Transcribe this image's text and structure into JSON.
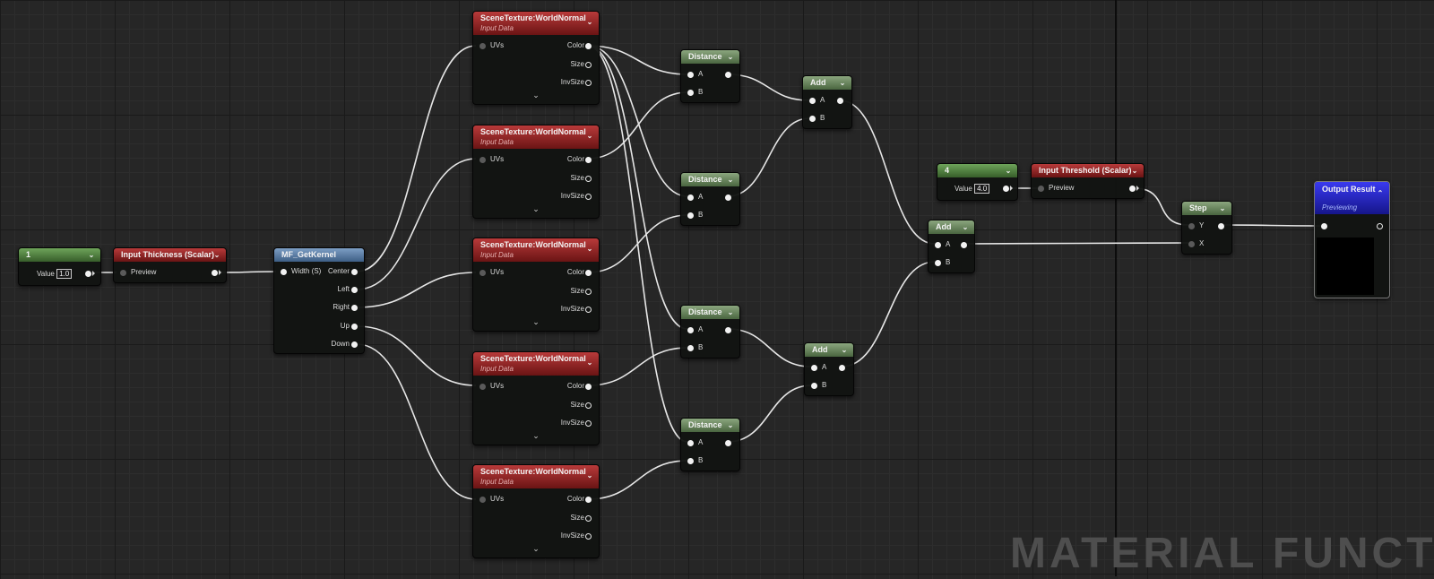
{
  "watermark": "MATERIAL FUNCTIO",
  "nodes": {
    "const1": {
      "title": "1",
      "value_label": "Value",
      "value": "1.0"
    },
    "thickness": {
      "title": "Input Thickness (Scalar)",
      "pin_label": "Preview"
    },
    "kernel": {
      "title": "MF_GetKernel",
      "input_label": "Width (S)",
      "outputs": [
        "Center",
        "Left",
        "Right",
        "Up",
        "Down"
      ]
    },
    "scenetex": [
      {
        "title": "SceneTexture:WorldNormal",
        "subtitle": "Input Data",
        "input": "UVs",
        "outputs": [
          "Color",
          "Size",
          "InvSize"
        ]
      },
      {
        "title": "SceneTexture:WorldNormal",
        "subtitle": "Input Data",
        "input": "UVs",
        "outputs": [
          "Color",
          "Size",
          "InvSize"
        ]
      },
      {
        "title": "SceneTexture:WorldNormal",
        "subtitle": "Input Data",
        "input": "UVs",
        "outputs": [
          "Color",
          "Size",
          "InvSize"
        ]
      },
      {
        "title": "SceneTexture:WorldNormal",
        "subtitle": "Input Data",
        "input": "UVs",
        "outputs": [
          "Color",
          "Size",
          "InvSize"
        ]
      },
      {
        "title": "SceneTexture:WorldNormal",
        "subtitle": "Input Data",
        "input": "UVs",
        "outputs": [
          "Color",
          "Size",
          "InvSize"
        ]
      }
    ],
    "distance": [
      {
        "title": "Distance",
        "a": "A",
        "b": "B"
      },
      {
        "title": "Distance",
        "a": "A",
        "b": "B"
      },
      {
        "title": "Distance",
        "a": "A",
        "b": "B"
      },
      {
        "title": "Distance",
        "a": "A",
        "b": "B"
      }
    ],
    "add": [
      {
        "title": "Add",
        "a": "A",
        "b": "B"
      },
      {
        "title": "Add",
        "a": "A",
        "b": "B"
      },
      {
        "title": "Add",
        "a": "A",
        "b": "B"
      }
    ],
    "const4": {
      "title": "4",
      "value_label": "Value",
      "value": "4.0"
    },
    "threshold": {
      "title": "Input Threshold (Scalar)",
      "pin_label": "Preview"
    },
    "step": {
      "title": "Step",
      "y": "Y",
      "x": "X"
    },
    "output": {
      "title": "Output Result",
      "subtitle": "Previewing"
    }
  },
  "icons": [
    "chevron-down-icon",
    "chevron-up-icon",
    "expand-chevron-icon",
    "pin-icon"
  ],
  "colors": {
    "grid_bg": "#262626",
    "constant_header": "#5a8f47",
    "parameter_header": "#9a2626",
    "function_header": "#5a7ea8",
    "math_header": "#6d8a60",
    "output_header": "#2a2ad0",
    "wire": "#e6e6e6"
  }
}
